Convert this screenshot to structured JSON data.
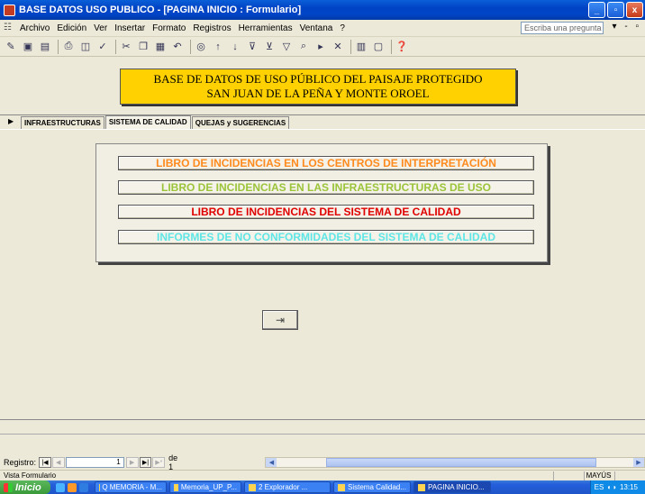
{
  "window": {
    "title": "BASE DATOS USO PUBLICO - [PAGINA INICIO : Formulario]",
    "buttons": [
      "_",
      "▫",
      "x"
    ]
  },
  "menubar": {
    "items": [
      "Archivo",
      "Edición",
      "Ver",
      "Insertar",
      "Formato",
      "Registros",
      "Herramientas",
      "Ventana",
      "?"
    ],
    "help_placeholder": "Escriba una pregunta",
    "right_controls": "▾ - ▫"
  },
  "form": {
    "header_line1": "BASE DE DATOS DE USO PÚBLICO DEL PAISAJE PROTEGIDO",
    "header_line2": "SAN JUAN DE LA PEÑA Y MONTE OROEL",
    "tabs": [
      {
        "label": "INFRAESTRUCTURAS",
        "active": false
      },
      {
        "label": "SISTEMA DE CALIDAD",
        "active": true
      },
      {
        "label": "QUEJAS y SUGERENCIAS",
        "active": false
      }
    ],
    "buttons": [
      {
        "label": "LIBRO DE INCIDENCIAS EN LOS CENTROS DE INTERPRETACIÓN",
        "color": "#ff8a1d"
      },
      {
        "label": "LIBRO DE INCIDENCIAS EN LAS INFRAESTRUCTURAS DE USO",
        "color": "#9bc43a"
      },
      {
        "label": "LIBRO DE INCIDENCIAS DEL SISTEMA DE CALIDAD",
        "color": "#e00000"
      },
      {
        "label": "INFORMES DE NO CONFORMIDADES DEL SISTEMA DE CALIDAD",
        "color": "#5ee6e6"
      }
    ],
    "exit_icon": "exit-door-icon"
  },
  "navigation": {
    "label": "Registro:",
    "current": "1",
    "of_text": "de 1"
  },
  "status": {
    "text": "Vista Formulario",
    "caps": "MAYÚS"
  },
  "taskbar": {
    "start": "Inicio",
    "tasks": [
      "Q MEMORIA - M...",
      "Memoria_UP_P...",
      "2 Explorador ...",
      "Sistema Calidad...",
      "PAGINA INICIO..."
    ],
    "lang": "ES",
    "time": "13:15"
  }
}
